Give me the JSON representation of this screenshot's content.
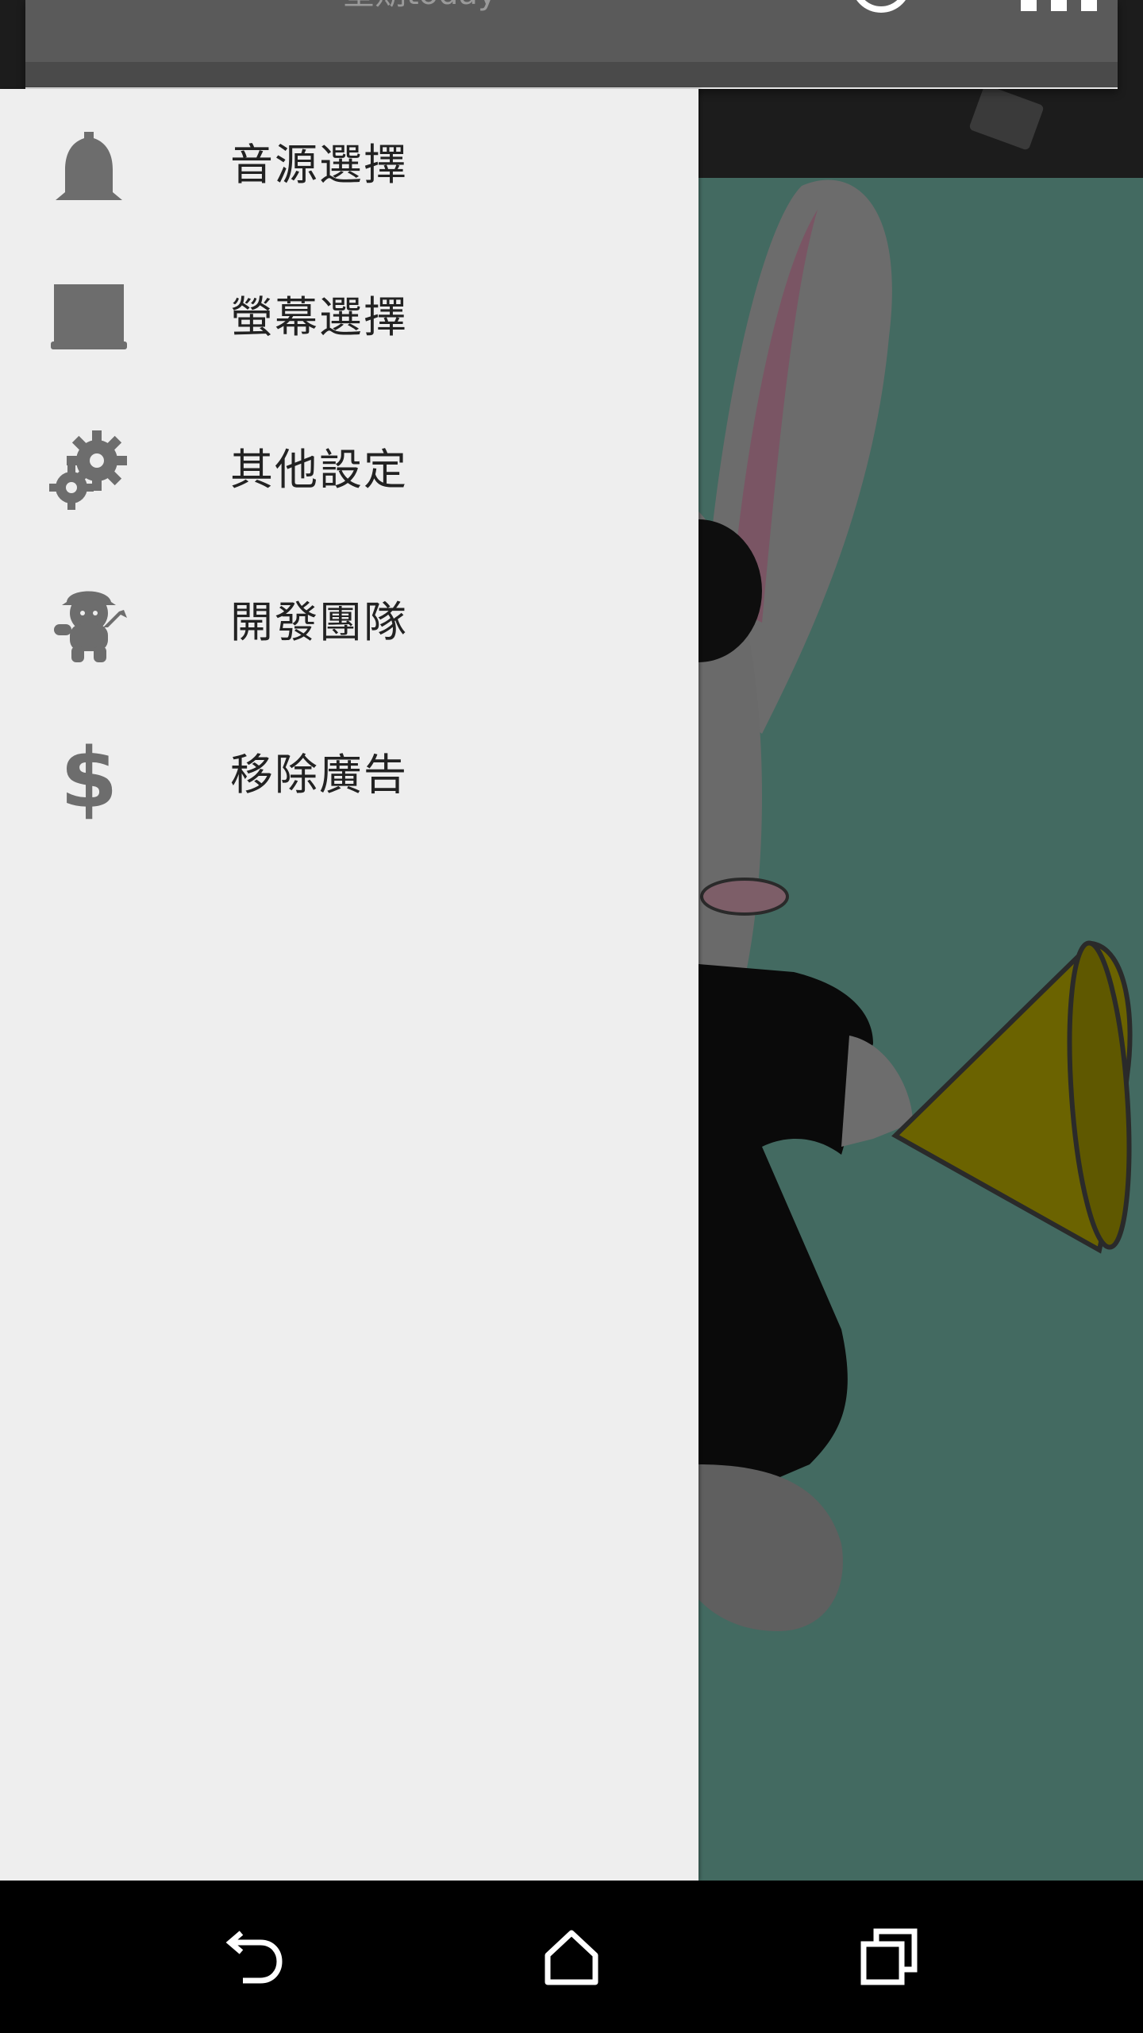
{
  "status_shade": {
    "day_text": "星期today"
  },
  "drawer": {
    "items": [
      {
        "label": "音源選擇",
        "icon": "bell-icon"
      },
      {
        "label": "螢幕選擇",
        "icon": "monitor-icon"
      },
      {
        "label": "其他設定",
        "icon": "gear-icon"
      },
      {
        "label": "開發團隊",
        "icon": "developer-mascot-icon"
      },
      {
        "label": "移除廣告",
        "icon": "dollar-icon"
      }
    ]
  },
  "navbar": {
    "back": "back-icon",
    "home": "home-icon",
    "recents": "recents-icon"
  },
  "colors": {
    "drawer_bg": "#eeeeee",
    "icon_gray": "#6d6d6d",
    "stage_bg": "#436a61",
    "megaphone": "#7a7000"
  }
}
